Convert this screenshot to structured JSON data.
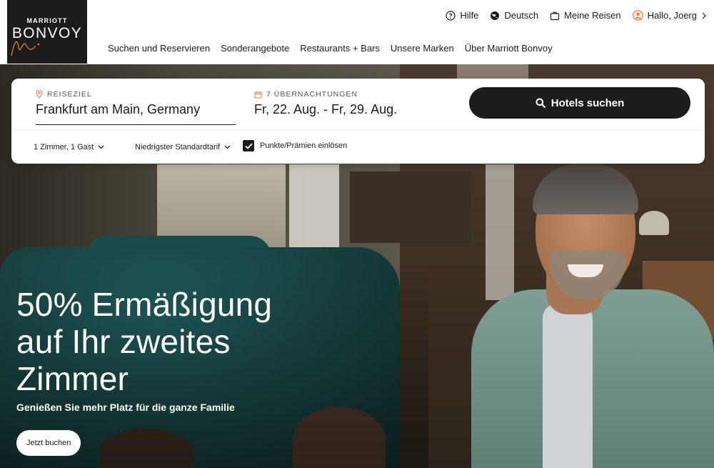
{
  "logo": {
    "line1": "MARRIOTT",
    "line2": "BONVOY"
  },
  "utility_nav": {
    "help": "Hilfe",
    "language": "Deutsch",
    "trips": "Meine Reisen",
    "greeting": "Hallo, Joerg"
  },
  "main_nav": [
    "Suchen und Reservieren",
    "Sonderangebote",
    "Restaurants + Bars",
    "Unsere Marken",
    "Über Marriott Bonvoy"
  ],
  "search": {
    "destination_label": "REISEZIEL",
    "destination_value": "Frankfurt am Main, Germany",
    "dates_label": "7 ÜBERNACHTUNGEN",
    "dates_value": "Fr, 22. Aug. - Fr, 29. Aug.",
    "search_button": "Hotels suchen",
    "rooms_guests": "1 Zimmer, 1 Gast",
    "rate": "Niedrigster Standardtarif",
    "points_label": "Punkte/Prämien einlösen",
    "points_checked": true
  },
  "promo": {
    "headline": "50% Ermäßigung auf Ihr zweites Zimmer",
    "subline": "Genießen Sie mehr Platz für die ganze Familie",
    "cta": "Jetzt buchen"
  },
  "colors": {
    "primary": "#1c1c1c",
    "accent_orange": "#e57a3c",
    "white": "#ffffff"
  }
}
